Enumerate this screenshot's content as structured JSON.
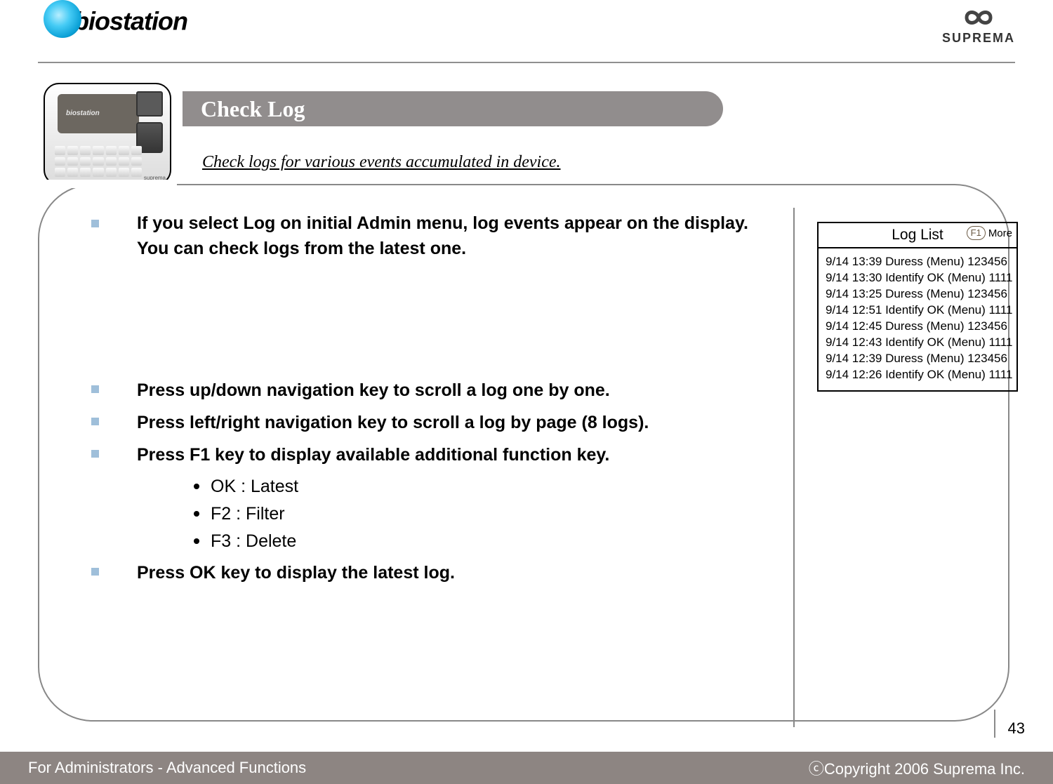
{
  "header": {
    "logo_left": "biostation",
    "logo_right": "SUPREMA"
  },
  "title": "Check Log",
  "subtitle": "Check logs for various events accumulated in device.",
  "intro": "If you select Log on initial Admin menu, log events appear on the display. You can check logs from the latest one.",
  "bullets": {
    "b1": "Press up/down navigation key to scroll a log one by one.",
    "b2": "Press left/right navigation key to scroll a log by page (8 logs).",
    "b3": "Press F1 key to display available additional function key.",
    "b4": "Press OK key to display the latest log."
  },
  "sub": {
    "s1": "OK : Latest",
    "s2": "F2 : Filter",
    "s3": "F3 : Delete"
  },
  "log_panel": {
    "title": "Log List",
    "f1_label": "F1",
    "more_label": "More",
    "rows": {
      "r0": "9/14 13:39 Duress (Menu) 123456",
      "r1": "9/14 13:30 Identify OK (Menu) 1111",
      "r2": "9/14 13:25 Duress (Menu) 123456",
      "r3": "9/14 12:51 Identify OK (Menu) 1111",
      "r4": "9/14 12:45 Duress (Menu) 123456",
      "r5": "9/14 12:43 Identify OK (Menu) 1111",
      "r6": "9/14 12:39 Duress (Menu) 123456",
      "r7": "9/14 12:26 Identify OK (Menu) 1111"
    }
  },
  "footer": {
    "left": "For Administrators - Advanced Functions",
    "right": "ⓒCopyright 2006 Suprema Inc."
  },
  "page_number": "43",
  "device_label": "biostation"
}
